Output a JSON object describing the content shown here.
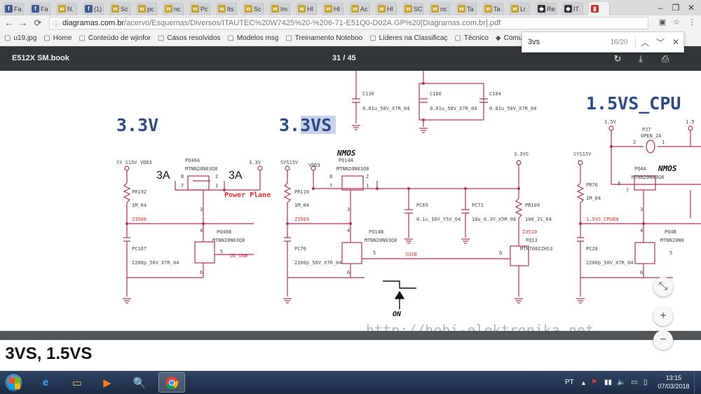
{
  "browser": {
    "tabs": [
      {
        "label": "Fa",
        "color": "#3b5998",
        "icon": "f"
      },
      {
        "label": "Fa",
        "color": "#3b5998",
        "icon": "f"
      },
      {
        "label": "N.",
        "color": "#c9a227",
        "icon": "w"
      },
      {
        "label": "(1)",
        "color": "#3b5998",
        "icon": "f"
      },
      {
        "label": "Sc",
        "color": "#c9a227",
        "icon": "w"
      },
      {
        "label": "pc",
        "color": "#c9a227",
        "icon": "w"
      },
      {
        "label": "nc",
        "color": "#c9a227",
        "icon": "w"
      },
      {
        "label": "Pc",
        "color": "#c9a227",
        "icon": "w"
      },
      {
        "label": "Its",
        "color": "#c9a227",
        "icon": "w"
      },
      {
        "label": "Sc",
        "color": "#c9a227",
        "icon": "w"
      },
      {
        "label": "Im",
        "color": "#c9a227",
        "icon": "w"
      },
      {
        "label": "HI",
        "color": "#c9a227",
        "icon": "w"
      },
      {
        "label": "HI",
        "color": "#c9a227",
        "icon": "w"
      },
      {
        "label": "Ac",
        "color": "#c9a227",
        "icon": "w"
      },
      {
        "label": "HI",
        "color": "#c9a227",
        "icon": "w"
      },
      {
        "label": "SC",
        "color": "#c9a227",
        "icon": "w"
      },
      {
        "label": "nc",
        "color": "#c9a227",
        "icon": "w"
      },
      {
        "label": "Ta",
        "color": "#c9a227",
        "icon": "w"
      },
      {
        "label": "Ta",
        "color": "#c9a227",
        "icon": "w"
      },
      {
        "label": "Li",
        "color": "#c9a227",
        "icon": "w"
      },
      {
        "label": "Re",
        "color": "#333333",
        "icon": "◆"
      },
      {
        "label": "IT",
        "color": "#333333",
        "icon": "◆"
      },
      {
        "label": "",
        "color": "#d93025",
        "icon": "▮",
        "active": true
      }
    ],
    "new_tab_icon": "new-tab-icon",
    "url_host": "diagramas.com.br",
    "url_path": "/acervo/Esquemas/Diversos/ITAUTEC%20W7425%20-%206-71-E51Q0-D02A.GP%20[Diagramas.com.br].pdf",
    "bookmarks": [
      {
        "label": "u19.jpg",
        "icon": "file-icon"
      },
      {
        "label": "Home",
        "icon": "file-icon"
      },
      {
        "label": "Conteúdo de wjinfor",
        "icon": "file-icon"
      },
      {
        "label": "Casos resolvidos",
        "icon": "file-icon"
      },
      {
        "label": "Modelos msg",
        "icon": "file-icon"
      },
      {
        "label": "Treinamento Noteboo",
        "icon": "file-icon"
      },
      {
        "label": "Líderes na Classificaç",
        "icon": "file-icon"
      },
      {
        "label": "Técnico",
        "icon": "file-icon"
      },
      {
        "label": "Comunidade Téc",
        "icon": "diamond-icon"
      }
    ]
  },
  "find": {
    "query": "3vs",
    "count": "16/20"
  },
  "pdf": {
    "title": "E512X SM.book",
    "page_current": "31",
    "page_sep": "/",
    "page_total": "45"
  },
  "schematic": {
    "heading_33v": "3.3V",
    "heading_33vs_prefix": "3.",
    "heading_33vs_match": "3VS",
    "heading_15vs": "1.5VS_CPU",
    "top": {
      "c130": "C130",
      "c130_val": "0.01u_50V_X7R_04",
      "c100": "C100",
      "c100_val": "0.01u_50V_X7R_04",
      "c184": "C184",
      "c184_val": "0.01u_50V_X7R_04"
    },
    "left": {
      "sys15v": "SY S15V",
      "vdd3": "VDD3",
      "v33": "3.3V",
      "amp1": "3A",
      "amp2": "3A",
      "q_name": "PQ40A",
      "q_part": "MTNN20N03Q8",
      "power_plane": "Power Plane",
      "r_name": "PR192",
      "r_val": "1M_04",
      "net": "Z3508",
      "q2_name": "PQ40B",
      "q2_part": "MTNN20N03Q8",
      "ddon": "DD_ON#",
      "c_name": "PC167",
      "c_val": "2200p_50V_X7R_04",
      "p8": "8",
      "p7": "7",
      "p2": "2",
      "p1": "1",
      "p3": "3",
      "p4": "4",
      "p5": "5",
      "p6": "6"
    },
    "mid": {
      "sys15v": "SYS15V",
      "vdd3": "VDD3",
      "nmos": "NMOS",
      "q_name": "PQ14A",
      "q_part": "MTNN20N03Q8",
      "v33vs": "3.3VS",
      "r_name": "PR110",
      "r_val": "1M_04",
      "net": "Z3509",
      "c69": "PC69",
      "c69_val": "0.1u_16V_Y5V_04",
      "c71": "PC71",
      "c71_val": "10u_6.3V_X5R_06",
      "r109": "PR109",
      "r109_val": "100_1%_04",
      "net2": "Z3510",
      "q2_name": "PQ14B",
      "q2_part": "MTNN20N03Q8",
      "c70": "PC70",
      "c70_val": "2200p_50V_X7R_04",
      "susb": "SUSB",
      "g": "G",
      "q13": "PQ13",
      "q13_part": "MTN7002ZHS3",
      "on": "ON",
      "p8": "8",
      "p7": "7",
      "p2": "2",
      "p1": "1",
      "p3": "3",
      "p4": "4",
      "p5": "5",
      "p6": "6"
    },
    "right": {
      "v15": "1.5V",
      "v15b": "1.5",
      "pj": "PJ7",
      "pj_val": "OPEN_2A",
      "sys15v": "SYS15V",
      "r76": "PR76",
      "r76_val": "1M_04",
      "net": "1.5VS_CPUEN",
      "nmos": "NMOS",
      "q_name": "PQ4A",
      "q_part": "MTNN20N03Q8",
      "q2_name": "PQ4B",
      "q2_part": "MTNN20N0",
      "c28": "PC28",
      "c28_val": "2200p_50V_X7R_04",
      "p2": "2",
      "p1": "1",
      "p8": "8",
      "p7": "7",
      "p3": "3",
      "p4": "4",
      "p5": "5",
      "p6": "6"
    },
    "watermark": "http://hobi-elektronika.net"
  },
  "next_page_heading": ", 3VS, 1.5VS",
  "taskbar": {
    "lang": "PT",
    "time": "13:15",
    "date": "07/03/2018"
  },
  "colors": {
    "wire": "#b03060",
    "net_red": "#e03030",
    "title_blue": "#2a4a8a",
    "find_highlight": "#c8d2ea",
    "pdf_toolbar": "#323639"
  }
}
